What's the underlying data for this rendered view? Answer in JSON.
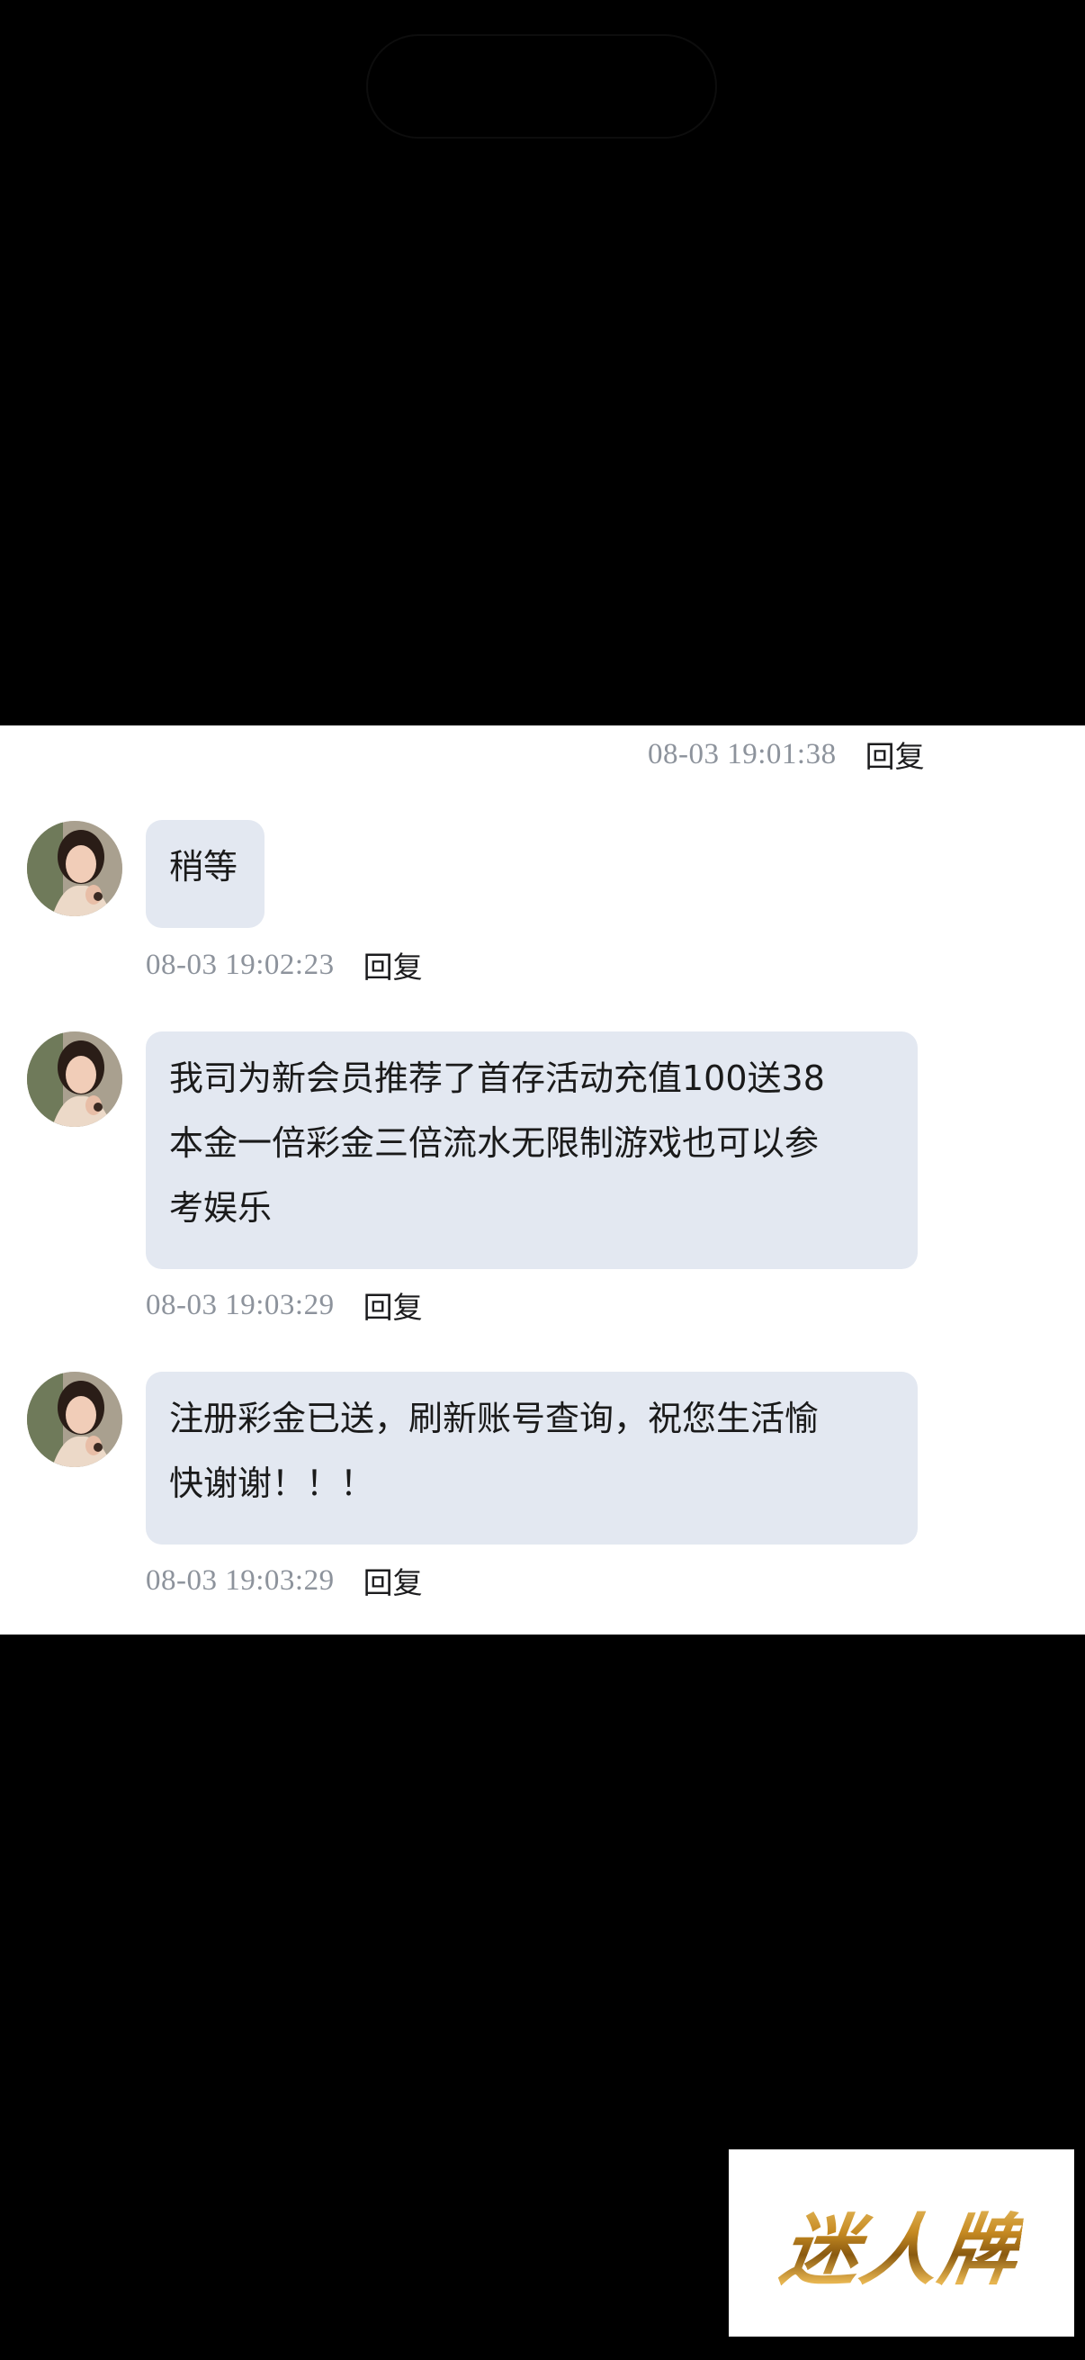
{
  "messages": [
    {
      "text": "",
      "time": "08-03 19:01:38",
      "reply_label": "回复"
    },
    {
      "text": "稍等",
      "time": "08-03 19:02:23",
      "reply_label": "回复"
    },
    {
      "lines": [
        "我司为新会员推荐了首存活动充值100送38",
        "本金一倍彩金三倍流水无限制游戏也可以参",
        "考娱乐"
      ],
      "time": "08-03 19:03:29",
      "reply_label": "回复"
    },
    {
      "lines": [
        "注册彩金已送，刷新账号查询，祝您生活愉",
        "快谢谢！！！"
      ],
      "time": "08-03 19:03:29",
      "reply_label": "回复"
    }
  ],
  "watermark": {
    "text": "迷人牌"
  },
  "colors": {
    "bubble": "#e3e8f1",
    "timestamp": "#8d939c",
    "panel": "#ffffff",
    "background": "#000000"
  }
}
